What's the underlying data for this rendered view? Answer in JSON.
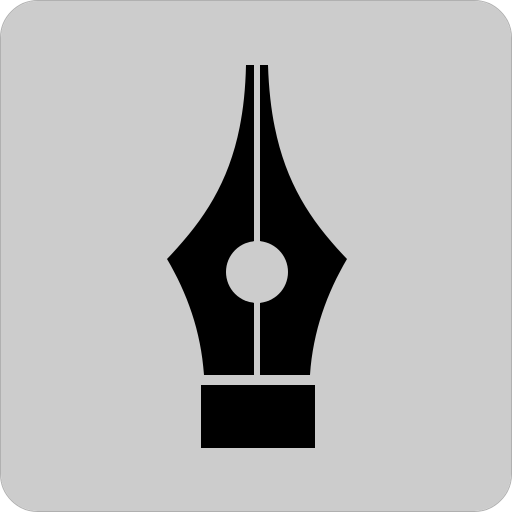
{
  "icon": {
    "name": "fountain-pen-nib-icon",
    "background_color": "#cccccc",
    "foreground_color": "#000000"
  }
}
